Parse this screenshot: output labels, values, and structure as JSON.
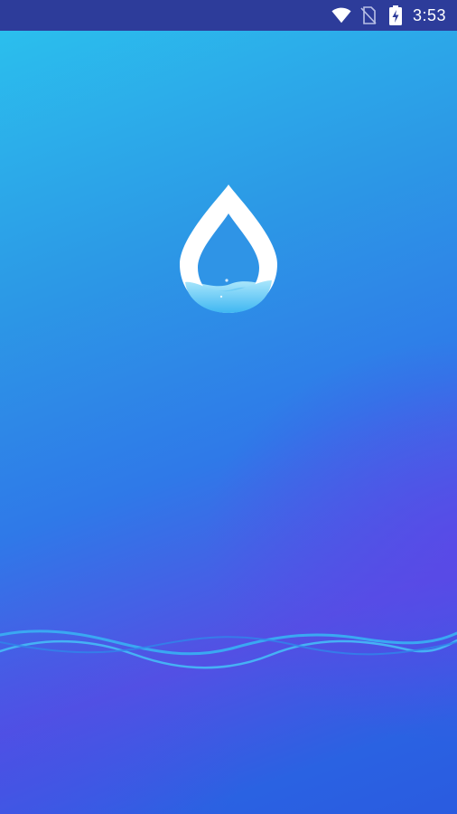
{
  "status_bar": {
    "time": "3:53",
    "icons": [
      "wifi-icon",
      "no-sim-icon",
      "battery-charging-icon"
    ],
    "background": "#2d3c9a"
  },
  "splash": {
    "logo_icon": "water-drop-icon",
    "wave_decoration": "wave-lines",
    "gradient_colors": [
      "#2bc3ee",
      "#2f79e8",
      "#5350e4",
      "#2a5be0"
    ]
  }
}
